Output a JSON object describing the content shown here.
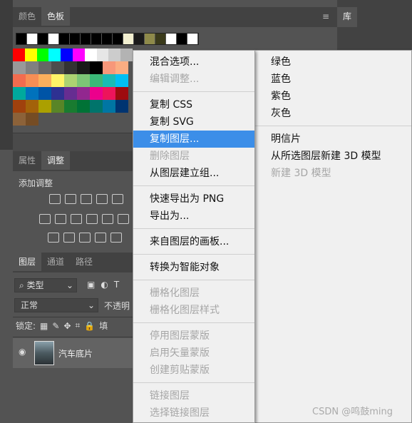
{
  "top_panel": {
    "tabs": [
      "颜色",
      "色板"
    ],
    "library_tab": "库"
  },
  "adjust_panel": {
    "tabs": [
      "属性",
      "调整"
    ],
    "add_label": "添加调整"
  },
  "layers_panel": {
    "tabs": [
      "图层",
      "通道",
      "路径"
    ],
    "filter_label": "类型",
    "blend_mode": "正常",
    "opacity_label": "不透明",
    "lock_label": "锁定:",
    "fill_label": "填",
    "layer_name": "汽车底片"
  },
  "context_menu": {
    "items": [
      {
        "label": "混合选项...",
        "disabled": false
      },
      {
        "label": "编辑调整...",
        "disabled": true
      },
      {
        "sep": true
      },
      {
        "label": "复制 CSS",
        "disabled": false
      },
      {
        "label": "复制 SVG",
        "disabled": false
      },
      {
        "label": "复制图层...",
        "disabled": false,
        "highlighted": true
      },
      {
        "label": "删除图层",
        "disabled": true
      },
      {
        "label": "从图层建立组...",
        "disabled": false
      },
      {
        "sep": true
      },
      {
        "label": "快速导出为 PNG",
        "disabled": false
      },
      {
        "label": "导出为...",
        "disabled": false
      },
      {
        "sep": true
      },
      {
        "label": "来自图层的画板...",
        "disabled": false
      },
      {
        "sep": true
      },
      {
        "label": "转换为智能对象",
        "disabled": false
      },
      {
        "sep": true
      },
      {
        "label": "栅格化图层",
        "disabled": true
      },
      {
        "label": "栅格化图层样式",
        "disabled": true
      },
      {
        "sep": true
      },
      {
        "label": "停用图层蒙版",
        "disabled": true
      },
      {
        "label": "启用矢量蒙版",
        "disabled": true
      },
      {
        "label": "创建剪贴蒙版",
        "disabled": true
      },
      {
        "sep": true
      },
      {
        "label": "链接图层",
        "disabled": true
      },
      {
        "label": "选择链接图层",
        "disabled": true
      }
    ]
  },
  "right_menu": {
    "items": [
      {
        "label": "绿色",
        "disabled": false
      },
      {
        "label": "蓝色",
        "disabled": false
      },
      {
        "label": "紫色",
        "disabled": false
      },
      {
        "label": "灰色",
        "disabled": false
      },
      {
        "sep": true
      },
      {
        "label": "明信片",
        "disabled": false
      },
      {
        "label": "从所选图层新建 3D 模型",
        "disabled": false
      },
      {
        "label": "新建 3D 模型",
        "disabled": true
      }
    ]
  },
  "watermark": "CSDN @鸣鼓ming",
  "swatch_colors": {
    "row1": [
      "#ff0000",
      "#ffff00",
      "#00ff00",
      "#00ffff",
      "#0000ff",
      "#ff00ff",
      "#ffffff",
      "#e6e6e6",
      "#cccccc",
      "#b3b3b3"
    ],
    "row2": [
      "#999999",
      "#808080",
      "#666666",
      "#4d4d4d",
      "#333333",
      "#1a1a1a",
      "#000000",
      "#f7977a",
      "#fbad82"
    ],
    "row3": [
      "#f26c4f",
      "#f68e55",
      "#fbaf5c",
      "#fff467",
      "#acd372",
      "#7cc576",
      "#3bb878",
      "#1abbb4",
      "#00bff3"
    ],
    "row4": [
      "#00a99d",
      "#0072bc",
      "#0054a6",
      "#2e3192",
      "#662d91",
      "#92278f",
      "#ec008c",
      "#ed145b",
      "#9e0b0f"
    ],
    "row5": [
      "#a0410d",
      "#a3620a",
      "#aba000",
      "#598527",
      "#197b30",
      "#007236",
      "#00746b",
      "#0076a3",
      "#003471"
    ],
    "row6": [
      "#8c6239",
      "#754c24"
    ],
    "top_strip": [
      "#000000",
      "#ffffff",
      "#000000",
      "#ffffff",
      "#000000",
      "#000000",
      "#000000",
      "#000000",
      "#000000",
      "#000000",
      "#f2efd0",
      "#1a1a1a",
      "#8e8a4a",
      "#3a3a1a",
      "#ffffff",
      "#000000",
      "#ffffff"
    ]
  }
}
